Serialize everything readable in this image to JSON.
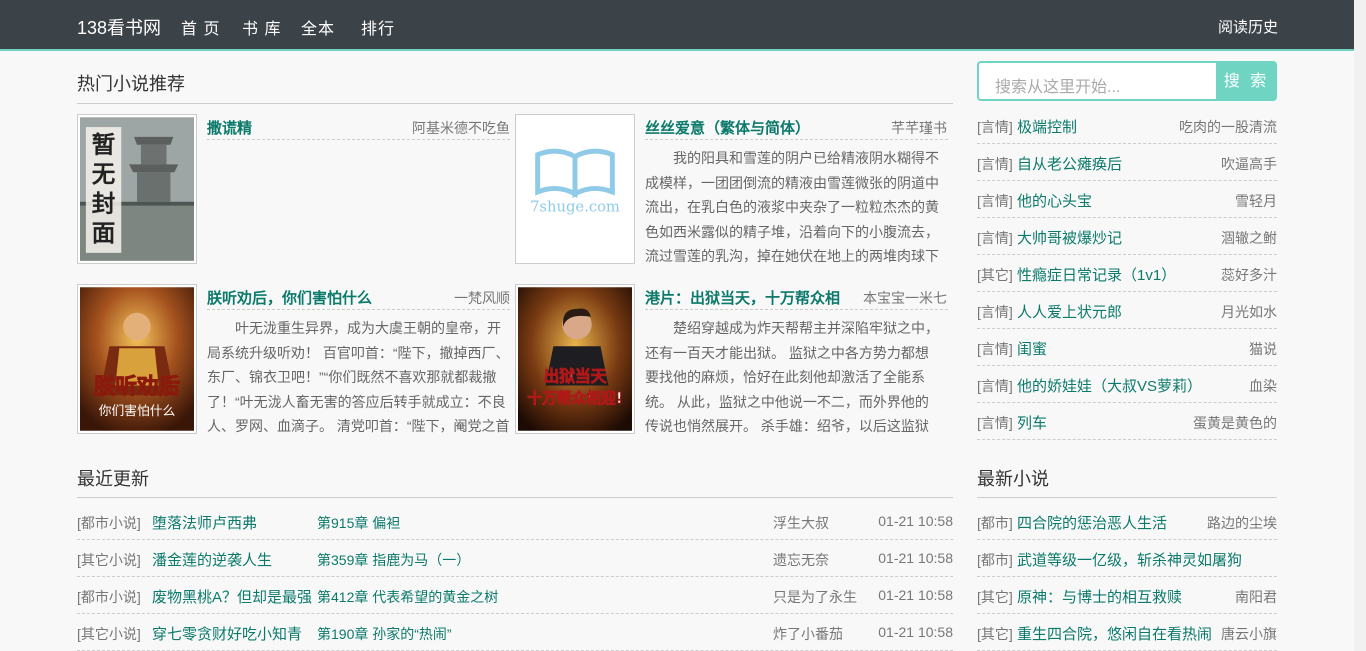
{
  "nav": {
    "brand": "138看书网",
    "items": [
      "首 页",
      "书 库",
      "全本",
      "排行"
    ],
    "history": "阅读历史"
  },
  "hot": {
    "title": "热门小说推荐",
    "books": [
      {
        "title": "撒谎精",
        "author": "阿基米德不吃鱼",
        "desc": "",
        "cover_text": "暂无封面"
      },
      {
        "title": "丝丝爱意（繁体与简体）",
        "author": "芊芊瑾书",
        "desc": "我的阳具和雪莲的阴户已给精液阴水糊得不成模样，一团团倒流的精液由雪莲微张的阴道中流出，在乳白色的液浆中夹杂了一粒粒杰杰的黄色如西米露似的精子堆，沿着向下的小腹流去，流过雪莲的乳沟，掉在她伏在地上的两堆肉球下",
        "cover_text": "7shuge.com"
      },
      {
        "title": "朕听劝后，你们害怕什么",
        "author": "一梵风顺",
        "desc": "叶无泷重生异界，成为大虞王朝的皇帝，开局系统升级听劝！ 百官叩首：“陛下，撤掉西厂、东厂、锦衣卫吧！”“你们既然不喜欢那就都裁撤了！“叶无泷人畜无害的答应后转手就成立：不良人、罗网、血滴子。 清党叩首：“陛下，阉党之首",
        "cover_text": "朕听劝后 你们害怕什么"
      },
      {
        "title": "港片：出狱当天，十万帮众相",
        "author": "本宝宝一米七",
        "desc": "楚绍穿越成为炸天帮帮主并深陷牢狱之中，还有一百天才能出狱。 监狱之中各方势力都想要找他的麻烦，恰好在此刻他却激活了全能系统。 从此，监狱之中他说一不二，而外界他的传说也悄然展开。 杀手雄：绍爷，以后这监狱中您说的",
        "cover_text": "出狱当天 十万帮众相迎!"
      }
    ]
  },
  "search": {
    "placeholder": "搜索从这里开始...",
    "button": "搜 索"
  },
  "side_list": [
    {
      "cat": "[言情]",
      "name": "极端控制",
      "author": "吃肉的一股清流"
    },
    {
      "cat": "[言情]",
      "name": "自从老公瘫痪后",
      "author": "吹逼高手"
    },
    {
      "cat": "[言情]",
      "name": "他的心头宝",
      "author": "雪轻月"
    },
    {
      "cat": "[言情]",
      "name": "大帅哥被爆炒记",
      "author": "涸辙之鲋"
    },
    {
      "cat": "[其它]",
      "name": "性瘾症日常记录（1v1）",
      "author": "蕊好多汁"
    },
    {
      "cat": "[言情]",
      "name": "人人爱上状元郎",
      "author": "月光如水"
    },
    {
      "cat": "[言情]",
      "name": "闺蜜",
      "author": "猫说"
    },
    {
      "cat": "[言情]",
      "name": "他的娇娃娃（大叔VS萝莉）",
      "author": "血染"
    },
    {
      "cat": "[言情]",
      "name": "列车",
      "author": "蛋黄是黄色的"
    }
  ],
  "recent": {
    "title": "最近更新",
    "rows": [
      {
        "cat": "[都市小说]",
        "name": "堕落法师卢西弗",
        "chapter": "第915章 偏袒",
        "author": "浮生大叔",
        "time": "01-21 10:58"
      },
      {
        "cat": "[其它小说]",
        "name": "潘金莲的逆袭人生",
        "chapter": "第359章 指鹿为马（一）",
        "author": "遗忘无奈",
        "time": "01-21 10:58"
      },
      {
        "cat": "[都市小说]",
        "name": "废物黑桃A？但却是最强",
        "chapter": "第412章 代表希望的黄金之树",
        "author": "只是为了永生",
        "time": "01-21 10:58"
      },
      {
        "cat": "[其它小说]",
        "name": "穿七零贪财好吃小知青",
        "chapter": "第190章 孙家的“热闹”",
        "author": "炸了小番茄",
        "time": "01-21 10:58"
      }
    ]
  },
  "newest": {
    "title": "最新小说",
    "rows": [
      {
        "cat": "[都市]",
        "name": "四合院的惩治恶人生活",
        "author": "路边的尘埃"
      },
      {
        "cat": "[都市]",
        "name": "武道等级一亿级，斩杀神灵如屠狗",
        "author": ""
      },
      {
        "cat": "[其它]",
        "name": "原神：与博士的相互救赎",
        "author": "南阳君"
      },
      {
        "cat": "[其它]",
        "name": "重生四合院，悠闲自在看热闹",
        "author": "唐云小旗"
      }
    ]
  }
}
